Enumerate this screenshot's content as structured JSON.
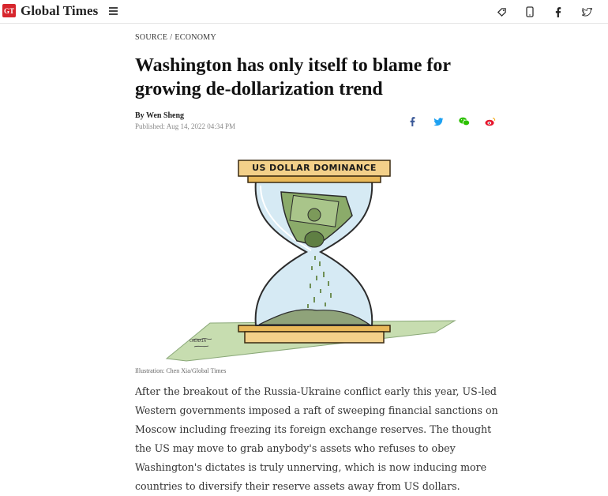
{
  "brand": {
    "logo_text": "GT",
    "name": "Global Times"
  },
  "header_icons": [
    "tag-icon",
    "mobile-icon",
    "facebook-icon",
    "twitter-icon"
  ],
  "article": {
    "section_source": "SOURCE",
    "section_separator": "/",
    "section_category": "ECONOMY",
    "title": "Washington has only itself to blame for growing de-dollarization trend",
    "byline": "By Wen Sheng",
    "published": "Published: Aug 14, 2022 04:34 PM",
    "share_icons": [
      "facebook-icon",
      "twitter-icon",
      "wechat-icon",
      "weibo-icon"
    ],
    "illustration_banner": "US DOLLAR DOMINANCE",
    "illustration_signature": "CHENXIA",
    "caption": "Illustration: Chen Xia/Global Times",
    "paragraph": "After the breakout of the Russia-Ukraine conflict early this year, US-led Western governments imposed a raft of sweeping financial sanctions on Moscow including freezing its foreign exchange reserves. The thought the US may move to grab anybody's assets who refuses to obey Washington's dictates is truly unnerving, which is now inducing more countries to diversify their reserve assets away from US dollars."
  },
  "colors": {
    "brand_red": "#d7262d",
    "facebook": "#3b5998",
    "twitter": "#1da1f2",
    "wechat": "#2dc100",
    "weibo": "#e6162d"
  }
}
